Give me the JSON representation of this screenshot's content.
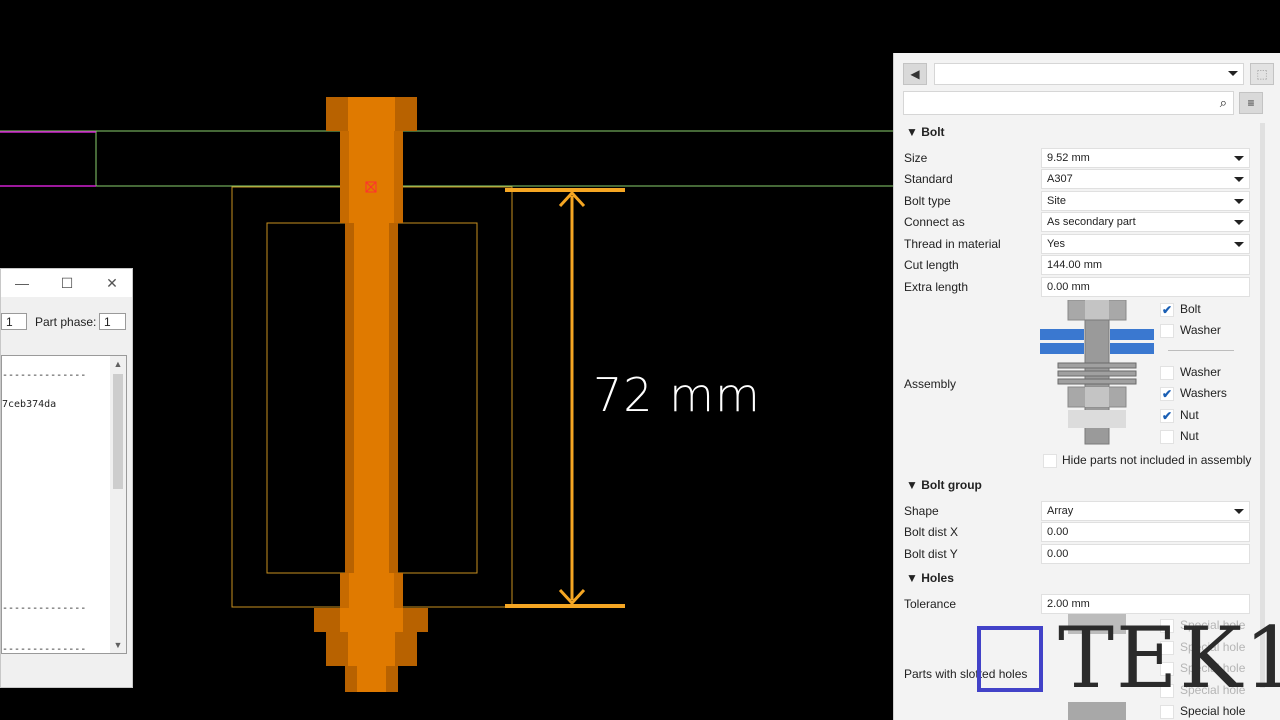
{
  "viewport": {
    "dimension_text": "72 mm",
    "colors": {
      "bolt": "#e07a00",
      "dimension": "#f5a623",
      "outline": "#c89020",
      "green_line": "#8ad06e",
      "magenta_line": "#d020d0"
    }
  },
  "dialog": {
    "title_buttons": {
      "minimize": "—",
      "maximize": "☐",
      "close": "✕"
    },
    "phase_value_left": "1",
    "part_phase_label": "Part phase:",
    "part_phase_value": "1",
    "log_lines": [
      "--------------",
      "7ceb374da",
      "--------------",
      "--------------"
    ]
  },
  "properties": {
    "back_icon": "◀",
    "menu_icon": "≡",
    "export_icon": "⬚",
    "search_icon": "⌕",
    "dropdown_value": "",
    "search_placeholder": "",
    "bolt_section": "Bolt",
    "fields": [
      {
        "label": "Size",
        "value": "9.52 mm",
        "type": "select"
      },
      {
        "label": "Standard",
        "value": "A307",
        "type": "select"
      },
      {
        "label": "Bolt type",
        "value": "Site",
        "type": "select"
      },
      {
        "label": "Connect as",
        "value": "As secondary part",
        "type": "select"
      },
      {
        "label": "Thread in material",
        "value": "Yes",
        "type": "select"
      },
      {
        "label": "Cut length",
        "value": "144.00 mm",
        "type": "input"
      },
      {
        "label": "Extra length",
        "value": "0.00 mm",
        "type": "input"
      }
    ],
    "assembly_label": "Assembly",
    "assembly_items": [
      {
        "label": "Bolt",
        "checked": true
      },
      {
        "label": "Washer",
        "checked": false
      },
      {
        "label": "Washer",
        "checked": false
      },
      {
        "label": "Washers",
        "checked": true
      },
      {
        "label": "Nut",
        "checked": true
      },
      {
        "label": "Nut",
        "checked": false
      }
    ],
    "hide_parts_label": "Hide parts not included in assembly",
    "bolt_group_section": "Bolt group",
    "group_fields": [
      {
        "label": "Shape",
        "value": "Array",
        "type": "select"
      },
      {
        "label": "Bolt dist X",
        "value": "0.00",
        "type": "input"
      },
      {
        "label": "Bolt dist Y",
        "value": "0.00",
        "type": "input"
      }
    ],
    "holes_section": "Holes",
    "tolerance_label": "Tolerance",
    "tolerance_value": "2.00 mm",
    "slotted_label": "Parts with slotted holes",
    "special_holes": [
      "Special hole",
      "Special hole",
      "Special hole",
      "Special hole",
      "Special hole"
    ]
  },
  "watermark": {
    "text": "TEK1"
  }
}
